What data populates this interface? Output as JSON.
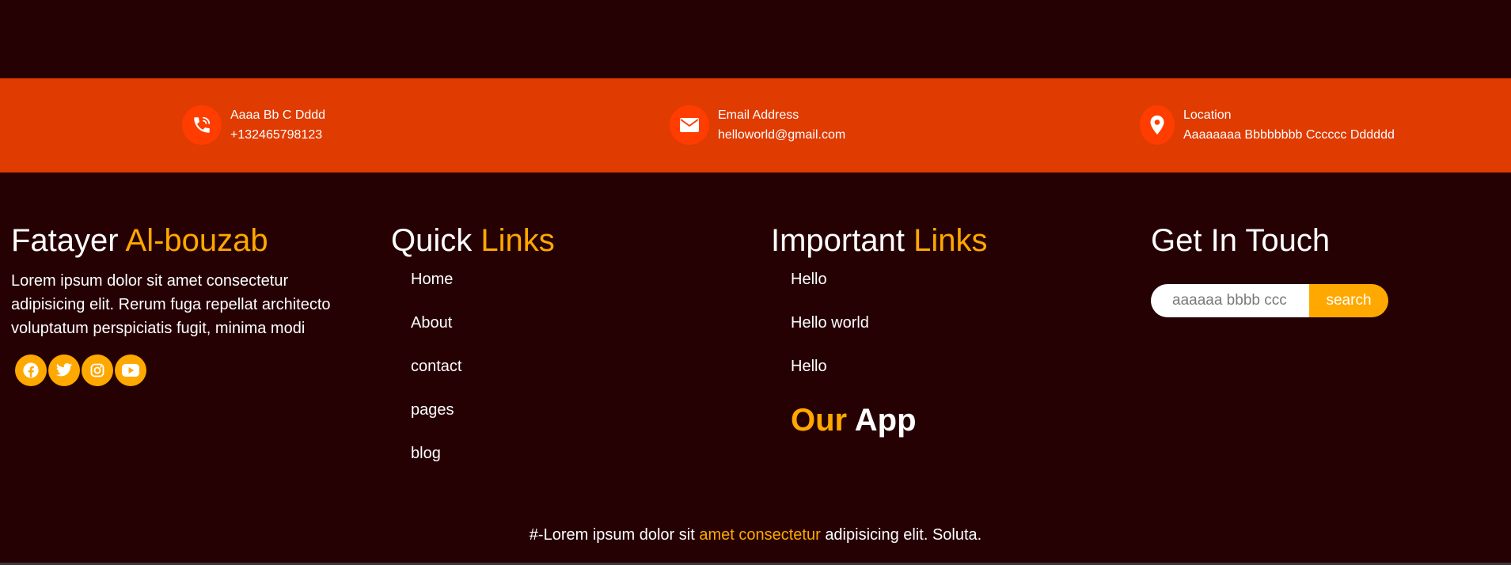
{
  "colors": {
    "background": "#260103",
    "strip": "#e03b00",
    "icon_bg": "#ff3d00",
    "accent": "#ffa800"
  },
  "contact": {
    "phone": {
      "icon": "phone-ring-icon",
      "title": "Aaaa Bb C Dddd",
      "value": "+132465798123"
    },
    "email": {
      "icon": "envelope-icon",
      "title": "Email Address",
      "value": "helloworld@gmail.com"
    },
    "location": {
      "icon": "map-pin-icon",
      "title": "Location",
      "value": "Aaaaaaaa Bbbbbbbb Cccccc Dddddd"
    }
  },
  "brand": {
    "title_main": "Fatayer",
    "title_accent": "Al-bouzab",
    "description": "Lorem ipsum dolor sit amet consectetur adipisicing elit. Rerum fuga repellat architecto voluptatum perspiciatis fugit, minima modi",
    "social": [
      "facebook-icon",
      "twitter-icon",
      "instagram-icon",
      "youtube-icon"
    ]
  },
  "quick_links": {
    "title_main": "Quick",
    "title_accent": "Links",
    "items": [
      "Home",
      "About",
      "contact",
      "pages",
      "blog"
    ]
  },
  "important_links": {
    "title_main": "Important",
    "title_accent": "Links",
    "items": [
      "Hello",
      "Hello world",
      "Hello"
    ],
    "app_title_accent": "Our",
    "app_title_main": "App"
  },
  "get_in_touch": {
    "title": "Get In Touch",
    "placeholder": "aaaaaa bbbb ccc",
    "button_label": "search"
  },
  "copyright": {
    "prefix": "#-Lorem ipsum dolor sit",
    "accent": "amet consectetur",
    "suffix": "adipisicing elit. Soluta."
  }
}
